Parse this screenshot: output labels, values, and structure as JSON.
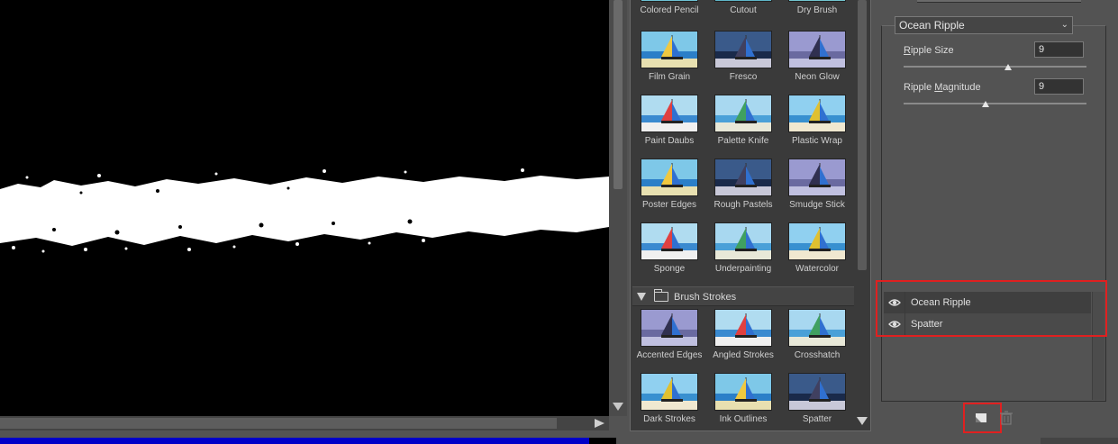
{
  "gallery": {
    "top_row": [
      "Colored Pencil",
      "Cutout",
      "Dry Brush"
    ],
    "artistic_rows": [
      [
        "Film Grain",
        "Fresco",
        "Neon Glow"
      ],
      [
        "Paint Daubs",
        "Palette Knife",
        "Plastic Wrap"
      ],
      [
        "Poster Edges",
        "Rough Pastels",
        "Smudge Stick"
      ],
      [
        "Sponge",
        "Underpainting",
        "Watercolor"
      ]
    ],
    "brush_strokes_folder": "Brush Strokes",
    "brush_rows": [
      [
        "Accented Edges",
        "Angled Strokes",
        "Crosshatch"
      ],
      [
        "Dark Strokes",
        "Ink Outlines",
        "Spatter"
      ]
    ]
  },
  "settings": {
    "selected_filter": "Ocean Ripple",
    "params": [
      {
        "label_pre": "",
        "label_u": "R",
        "label_post": "ipple Size",
        "value": "9",
        "slider_fraction": 0.57
      },
      {
        "label_pre": "Ripple ",
        "label_u": "M",
        "label_post": "agnitude",
        "value": "9",
        "slider_fraction": 0.45
      }
    ]
  },
  "effect_layers": [
    {
      "name": "Ocean Ripple",
      "active": true
    },
    {
      "name": "Spatter",
      "active": false
    }
  ],
  "colors": {
    "highlight": "#e02020",
    "progress": "#0000c8"
  },
  "icons": {
    "visibility": "eye-icon",
    "new_layer": "new-effect-layer-icon",
    "delete_layer": "trash-icon"
  }
}
